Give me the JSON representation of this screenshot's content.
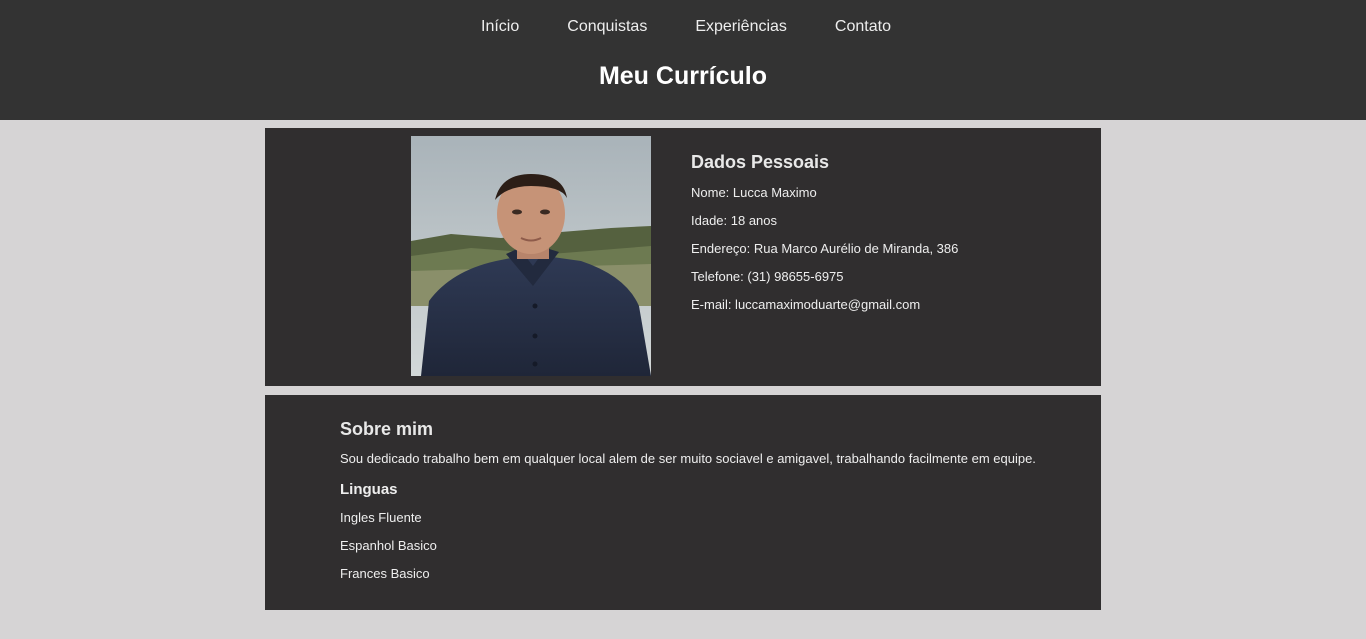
{
  "nav": {
    "items": [
      "Início",
      "Conquistas",
      "Experiências",
      "Contato"
    ]
  },
  "header": {
    "title": "Meu Currículo"
  },
  "personal": {
    "heading": "Dados Pessoais",
    "photo_subject": "profile-photo",
    "fields": [
      "Nome: Lucca Maximo",
      "Idade: 18 anos",
      "Endereço: Rua Marco Aurélio de Miranda, 386",
      "Telefone: (31) 98655-6975",
      "E-mail: luccamaximoduarte@gmail.com"
    ]
  },
  "about": {
    "heading": "Sobre mim",
    "description": "Sou dedicado trabalho bem em qualquer local alem de ser muito sociavel e amigavel, trabalhando facilmente em equipe.",
    "languages_heading": "Linguas",
    "languages": [
      "Ingles Fluente",
      "Espanhol Basico",
      "Frances Basico"
    ]
  },
  "colors": {
    "header_bg": "#333333",
    "page_bg": "#d6d4d5",
    "card_bg": "#302e2f",
    "text": "#eeeeee"
  }
}
